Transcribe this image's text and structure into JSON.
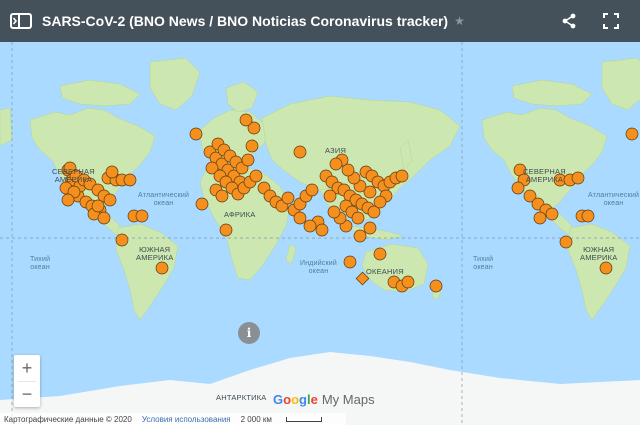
{
  "header": {
    "title": "SARS-CoV-2 (BNO News / BNO Noticias Coronavirus tracker)",
    "panel_icon": "sidebar-panel-icon",
    "star_icon": "star-icon",
    "share_icon": "share-icon",
    "fullscreen_icon": "fullscreen-icon"
  },
  "map": {
    "labels": {
      "north_america": "СЕВЕРНАЯ\nАМЕРИКА",
      "north_america_repeat": "СЕВЕРНАЯ\nАМЕРИКА",
      "asia": "АЗИЯ",
      "atlantic": "Атлантический\nокеан",
      "atlantic_repeat": "Атлантический\nокеан",
      "africa": "АФРИКА",
      "south_america": "ЮЖНАЯ\nАМЕРИКА",
      "south_america_repeat": "ЮЖНАЯ\nАМЕРИКА",
      "pacific_left": "Тихий\nокеан",
      "pacific_right": "Тихий\nокеан",
      "indian": "Индийский\nокеан",
      "oceania": "ОКЕАНИЯ",
      "antarctica": "АНТАРКТИКА"
    },
    "colors": {
      "water": "#aadaff",
      "land": "#cde7b0",
      "ice": "#f5f7f7",
      "marker": "#f5901e",
      "marker_stroke": "#5a3a10"
    },
    "marker_icon": "circle-marker-icon",
    "special_marker_icon": "diamond-marker-icon"
  },
  "controls": {
    "zoom_in": "+",
    "zoom_out": "−",
    "info": "i"
  },
  "branding": {
    "google": "Google",
    "my_maps": "My Maps"
  },
  "attribution": {
    "map_data": "Картографические данные © 2020",
    "terms": "Условия использования",
    "scale": "2 000 км"
  }
}
